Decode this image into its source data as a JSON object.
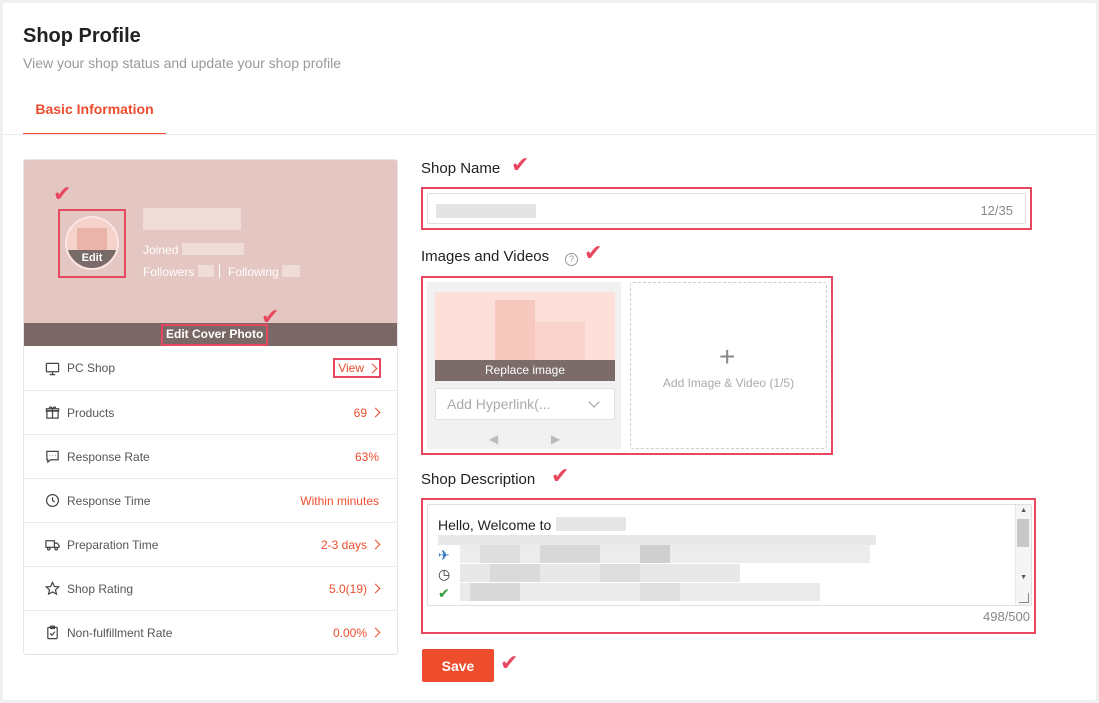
{
  "header": {
    "title": "Shop Profile",
    "subtitle": "View your shop status and update your shop profile",
    "tab_basic": "Basic Information"
  },
  "profile_card": {
    "avatar_edit": "Edit",
    "joined_label": "Joined",
    "followers_label": "Followers",
    "following_label": "Following",
    "edit_cover": "Edit Cover Photo"
  },
  "stats": [
    {
      "label": "PC Shop",
      "value": "View",
      "icon": "monitor-icon"
    },
    {
      "label": "Products",
      "value": "69",
      "icon": "gift-icon"
    },
    {
      "label": "Response Rate",
      "value": "63%",
      "icon": "chat-icon"
    },
    {
      "label": "Response Time",
      "value": "Within minutes",
      "icon": "clock-icon"
    },
    {
      "label": "Preparation Time",
      "value": "2-3 days",
      "icon": "truck-icon"
    },
    {
      "label": "Shop Rating",
      "value": "5.0(19)",
      "icon": "star-icon"
    },
    {
      "label": "Non-fulfillment Rate",
      "value": "0.00%",
      "icon": "clipboard-icon"
    }
  ],
  "form": {
    "shop_name_label": "Shop Name",
    "shop_name_count": "12/35",
    "media_label": "Images and Videos",
    "replace_image": "Replace image",
    "hyperlink_placeholder": "Add Hyperlink(...",
    "add_media": "Add Image & Video (1/5)",
    "desc_label": "Shop Description",
    "desc_text": "Hello, Welcome to",
    "desc_count": "498/500",
    "save": "Save"
  },
  "colors": {
    "accent": "#ee4d2d",
    "annotation": "#e8485f"
  }
}
